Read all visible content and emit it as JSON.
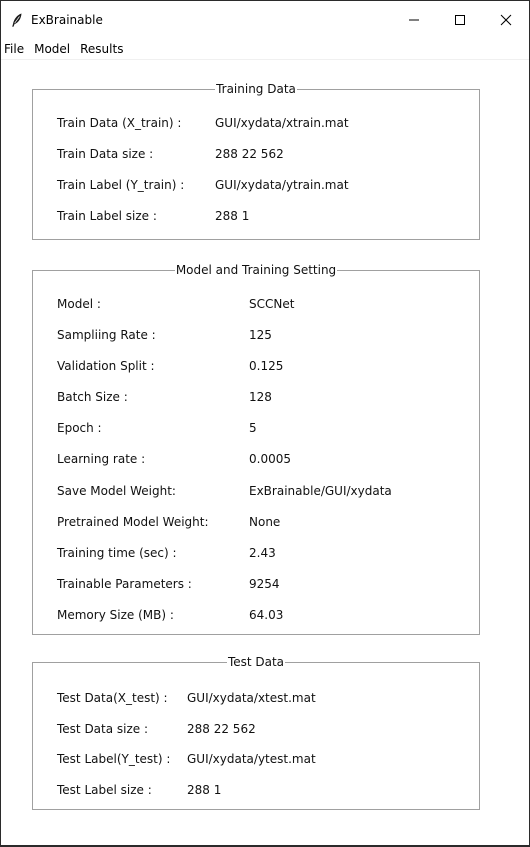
{
  "window": {
    "title": "ExBrainable",
    "app_icon": "feather-icon",
    "controls": [
      "minimize-icon",
      "maximize-icon",
      "close-icon"
    ]
  },
  "menu": {
    "items": [
      {
        "label": "File"
      },
      {
        "label": "Model"
      },
      {
        "label": "Results"
      }
    ]
  },
  "training_data": {
    "legend": "Training Data",
    "rows": [
      {
        "label": "Train Data (X_train) :",
        "value": "GUI/xydata/xtrain.mat"
      },
      {
        "label": "Train Data size :",
        "value": "288 22 562"
      },
      {
        "label": "Train Label (Y_train) :",
        "value": "GUI/xydata/ytrain.mat"
      },
      {
        "label": "Train Label size :",
        "value": "288 1"
      }
    ]
  },
  "model_setting": {
    "legend": "Model and Training Setting",
    "rows": [
      {
        "label": "Model :",
        "value": "SCCNet"
      },
      {
        "label": "Sampliing Rate :",
        "value": "125"
      },
      {
        "label": "Validation Split :",
        "value": "0.125"
      },
      {
        "label": "Batch Size :",
        "value": "128"
      },
      {
        "label": "Epoch :",
        "value": "5"
      },
      {
        "label": "Learning rate :",
        "value": "0.0005"
      },
      {
        "label": "Save Model Weight:",
        "value": "ExBrainable/GUI/xydata"
      },
      {
        "label": "Pretrained Model Weight:",
        "value": "None"
      },
      {
        "label": "Training time (sec) :",
        "value": "2.43"
      },
      {
        "label": "Trainable Parameters :",
        "value": "9254"
      },
      {
        "label": "Memory Size (MB) :",
        "value": "64.03"
      }
    ]
  },
  "test_data": {
    "legend": "Test Data",
    "rows": [
      {
        "label": "Test Data(X_test) :",
        "value": "GUI/xydata/xtest.mat"
      },
      {
        "label": "Test Data size :",
        "value": "288 22 562"
      },
      {
        "label": "Test Label(Y_test) :",
        "value": "GUI/xydata/ytest.mat"
      },
      {
        "label": "Test Label size :",
        "value": "288 1"
      }
    ]
  }
}
